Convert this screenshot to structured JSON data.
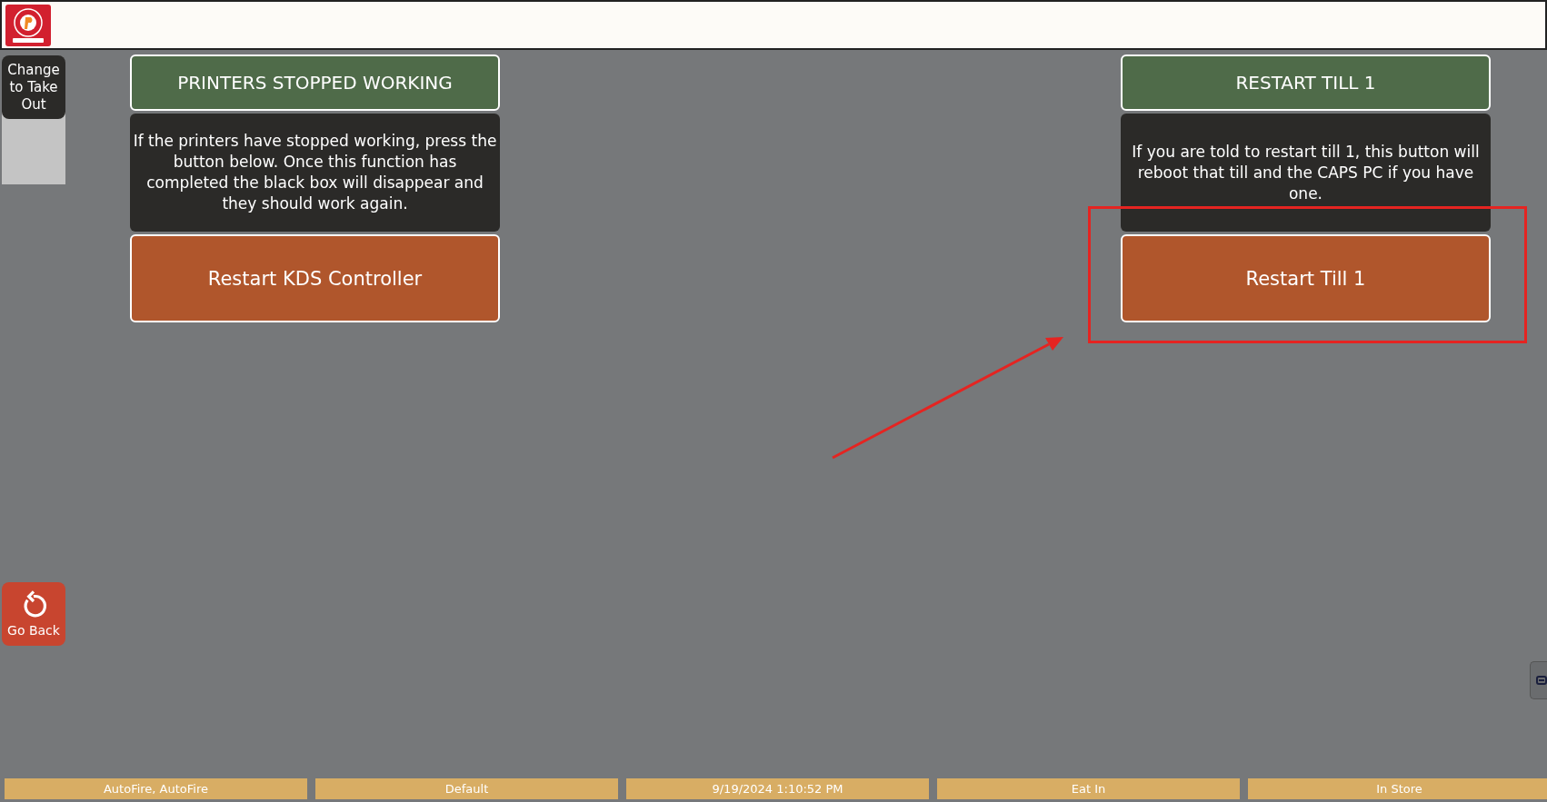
{
  "sidebar": {
    "change_button": "Change to Take Out",
    "back_button": "Go Back"
  },
  "cards": [
    {
      "title": "PRINTERS STOPPED WORKING",
      "description": "If the printers have stopped working, press the button below. Once this function has completed the black box will disappear and they should work again.",
      "action": "Restart KDS Controller"
    },
    {
      "title": "RESTART TILL 1",
      "description": "If you are told to restart till 1, this button will reboot that till and the CAPS PC if you have one.",
      "action": "Restart Till 1"
    }
  ],
  "status_bar": [
    "AutoFire, AutoFire",
    "Default",
    "9/19/2024 1:10:52 PM",
    "Eat In",
    "In Store"
  ]
}
